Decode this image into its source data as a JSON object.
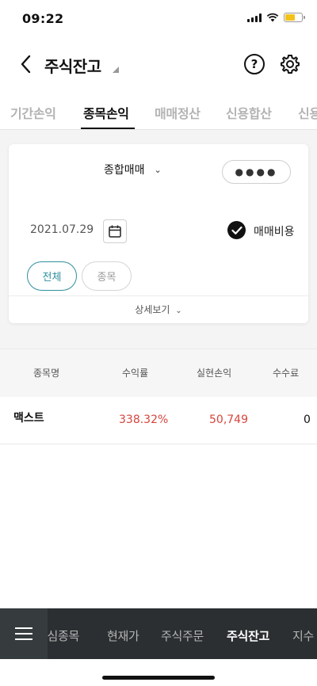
{
  "status": {
    "time": "09:22"
  },
  "header": {
    "title": "주식잔고",
    "help_label": "?"
  },
  "tabs": [
    {
      "label": "기간손익",
      "active": false
    },
    {
      "label": "종목손익",
      "active": true
    },
    {
      "label": "매매정산",
      "active": false
    },
    {
      "label": "신용합산",
      "active": false
    },
    {
      "label": "신용",
      "active": false
    }
  ],
  "filters": {
    "account_type": "종합매매",
    "password_mask": "●●●●",
    "date": "2021.07.29",
    "fee_label": "매매비용",
    "fee_checked": true,
    "all_label": "전체",
    "stock_label": "종목",
    "detail_label": "상세보기"
  },
  "table": {
    "headers": [
      "종목명",
      "수익률",
      "실현손익",
      "수수료"
    ],
    "rows": [
      {
        "name": "맥스트",
        "return_rate": "338.32%",
        "realized_pnl": "50,749",
        "fee": "0"
      }
    ]
  },
  "bottom_nav": {
    "items": [
      {
        "label": "관심종목",
        "active": false
      },
      {
        "label": "현재가",
        "active": false
      },
      {
        "label": "주식주문",
        "active": false
      },
      {
        "label": "주식잔고",
        "active": true
      },
      {
        "label": "지수",
        "active": false
      }
    ]
  },
  "colors": {
    "accent": "#2f8f9e",
    "positive": "#d6453d",
    "nav_bg": "#2b2f31"
  }
}
